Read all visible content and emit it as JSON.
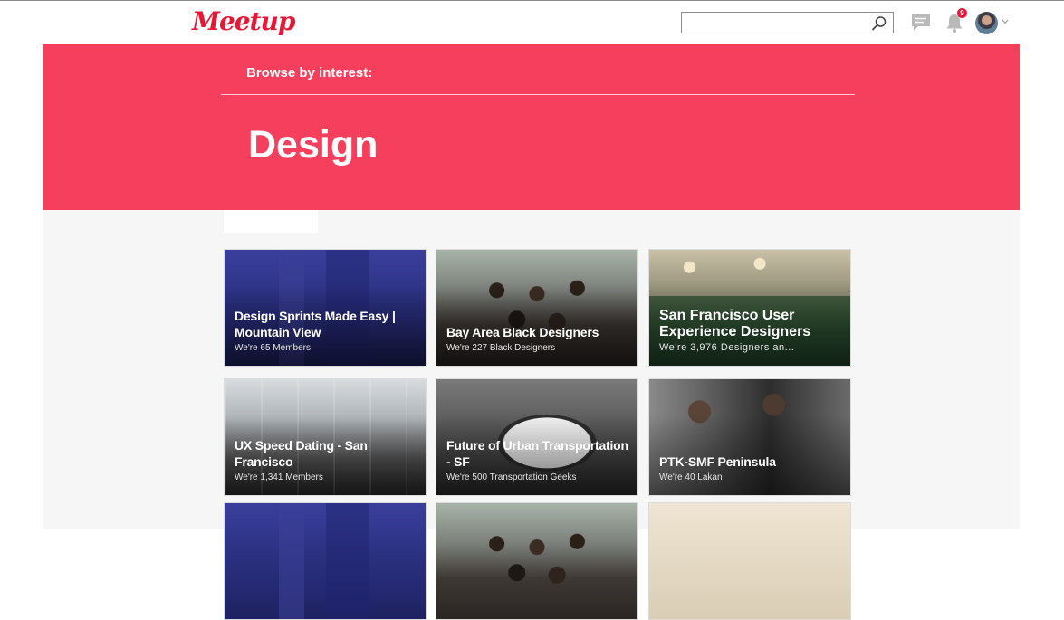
{
  "nav": {
    "logo": "Meetup",
    "search": {
      "value": "",
      "placeholder": ""
    },
    "notifications_count": "9"
  },
  "hero": {
    "browse_label": "Browse by interest:",
    "title": "Design"
  },
  "groups": [
    {
      "title": "Design Sprints Made Easy | Mountain View",
      "subtitle": "We're 65 Members"
    },
    {
      "title": "Bay Area Black Designers",
      "subtitle": "We're 227 Black Designers"
    },
    {
      "title": "San Francisco User Experience Designers",
      "subtitle": "We're 3,976 Designers an..."
    },
    {
      "title": "UX Speed Dating - San Francisco",
      "subtitle": "We're 1,341 Members"
    },
    {
      "title": "Future of Urban Transportation - SF",
      "subtitle": "We're 500 Transportation Geeks"
    },
    {
      "title": "PTK-SMF Peninsula",
      "subtitle": "We're 40 Lakan"
    },
    {
      "title": "",
      "subtitle": ""
    },
    {
      "title": "",
      "subtitle": ""
    },
    {
      "title": "",
      "subtitle": ""
    }
  ],
  "icons": {
    "search": "search-icon",
    "chat": "chat-icon",
    "bell": "bell-icon",
    "chevron": "chevron-down-icon"
  },
  "colors": {
    "brand_red": "#f63f5d",
    "logo_red": "#e51937",
    "page_bg": "#f6f6f6"
  }
}
